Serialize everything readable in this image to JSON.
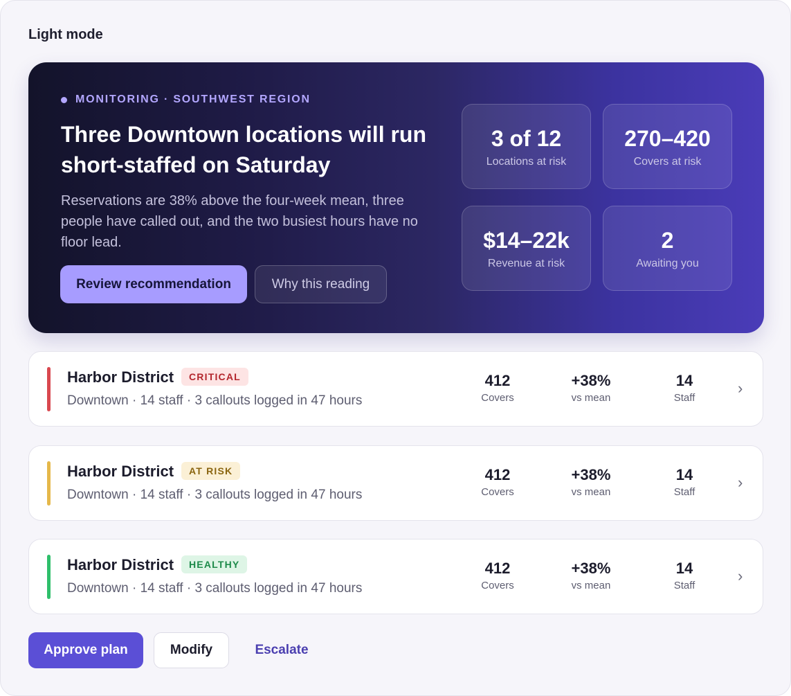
{
  "mode_label": "Light mode",
  "hero": {
    "eyebrow": "MONITORING · SOUTHWEST REGION",
    "title": "Three Downtown locations will run short-staffed on Saturday",
    "body": "Reservations are 38% above the four-week mean, three people have called out, and the two busiest hours have no floor lead.",
    "primary_button": "Review recommendation",
    "secondary_button": "Why this reading",
    "stats": [
      {
        "value": "3 of 12",
        "label": "Locations at risk"
      },
      {
        "value": "270–420",
        "label": "Covers at risk"
      },
      {
        "value": "$14–22k",
        "label": "Revenue at risk"
      },
      {
        "value": "2",
        "label": "Awaiting you"
      }
    ]
  },
  "locations": [
    {
      "name": "Harbor District",
      "status": "CRITICAL",
      "status_color": "#d9484f",
      "badge_bg": "#fde4e4",
      "badge_fg": "#b3262d",
      "subtitle": "Downtown · 14 staff · 3 callouts logged in 47 hours",
      "metrics": [
        {
          "value": "412",
          "label": "Covers"
        },
        {
          "value": "+38%",
          "label": "vs mean"
        },
        {
          "value": "14",
          "label": "Staff"
        }
      ]
    },
    {
      "name": "Harbor District",
      "status": "AT RISK",
      "status_color": "#e5b84a",
      "badge_bg": "#fbf0d6",
      "badge_fg": "#8a6510",
      "subtitle": "Downtown · 14 staff · 3 callouts logged in 47 hours",
      "metrics": [
        {
          "value": "412",
          "label": "Covers"
        },
        {
          "value": "+38%",
          "label": "vs mean"
        },
        {
          "value": "14",
          "label": "Staff"
        }
      ]
    },
    {
      "name": "Harbor District",
      "status": "HEALTHY",
      "status_color": "#2fbf6b",
      "badge_bg": "#def5e6",
      "badge_fg": "#1d8a4a",
      "subtitle": "Downtown · 14 staff · 3 callouts logged in 47 hours",
      "metrics": [
        {
          "value": "412",
          "label": "Covers"
        },
        {
          "value": "+38%",
          "label": "vs mean"
        },
        {
          "value": "14",
          "label": "Staff"
        }
      ]
    }
  ],
  "actions": {
    "approve": "Approve plan",
    "modify": "Modify",
    "escalate": "Escalate"
  },
  "icons": {
    "row_chevron": "chevron-right-icon",
    "eyebrow_dot": "status-dot-icon"
  }
}
